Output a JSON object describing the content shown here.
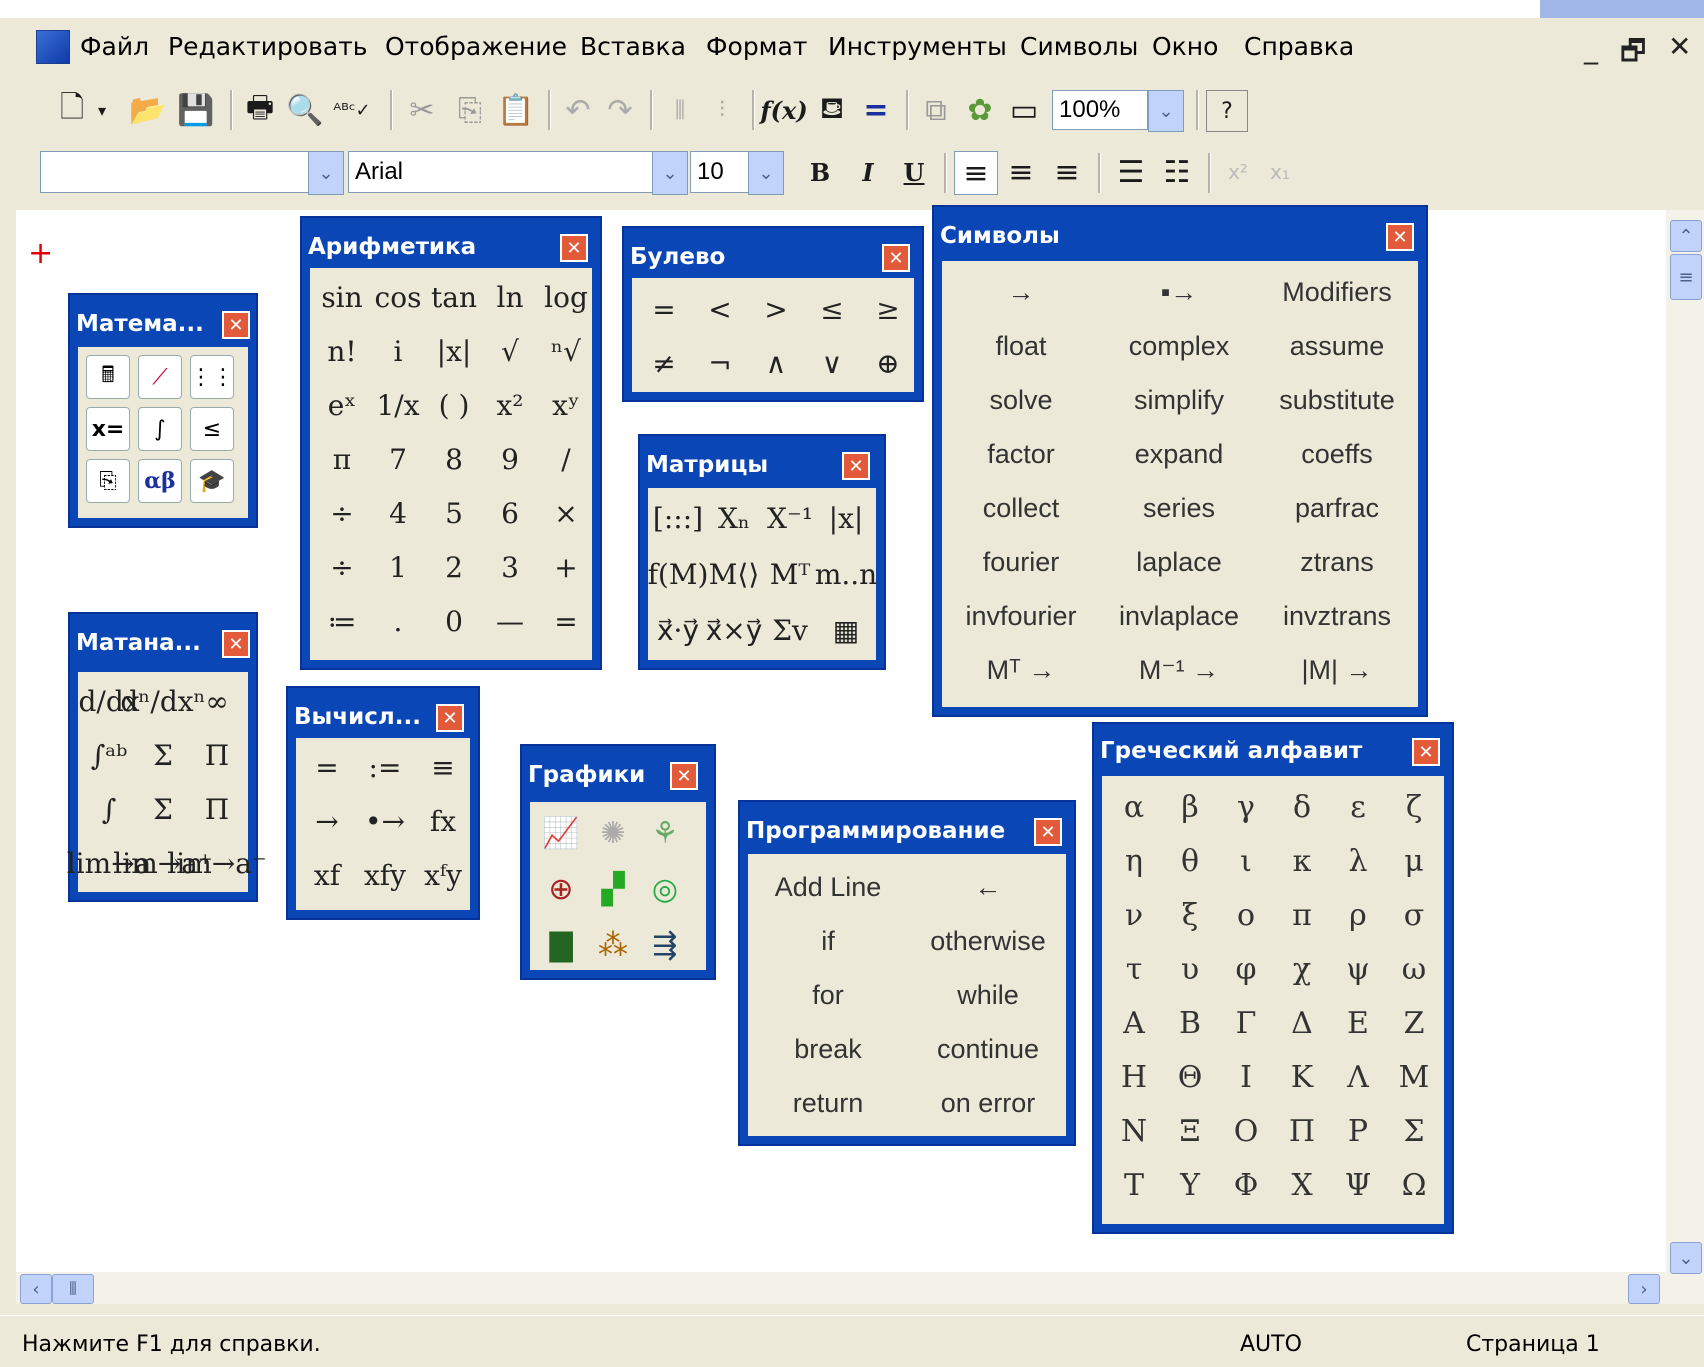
{
  "menu": [
    "Файл",
    "Редактировать",
    "Отображение",
    "Вставка",
    "Формат",
    "Инструменты",
    "Символы",
    "Окно",
    "Справка"
  ],
  "window_controls": {
    "minimize": "_",
    "maximize": "🗗",
    "close": "✕"
  },
  "toolbar": {
    "zoom": "100%",
    "font": "Arial",
    "size": "10",
    "style": "",
    "bold": "B",
    "italic": "I",
    "underline": "U"
  },
  "palettes": {
    "math": {
      "title": "Матема..."
    },
    "calculus": {
      "title": "Матана...",
      "cells": [
        "d/dx",
        "dⁿ/dxⁿ",
        "∞",
        "∫ᵃᵇ",
        "Σ",
        "Π",
        "∫",
        "Σ",
        "Π",
        "lim→a",
        "lim→a⁺",
        "lim→a⁻"
      ]
    },
    "arith": {
      "title": "Арифметика",
      "cells": [
        "sin",
        "cos",
        "tan",
        "ln",
        "log",
        "n!",
        "i",
        "|x|",
        "√",
        "ⁿ√",
        "eˣ",
        "1/x",
        "( )",
        "x²",
        "xʸ",
        "π",
        "7",
        "8",
        "9",
        "/",
        "÷",
        "4",
        "5",
        "6",
        "×",
        "÷",
        "1",
        "2",
        "3",
        "+",
        "≔",
        ".",
        "0",
        "—",
        "="
      ]
    },
    "eval": {
      "title": "Вычисл...",
      "cells": [
        "=",
        ":=",
        "≡",
        "→",
        "•→",
        "fx",
        "xf",
        "xfy",
        "xᶠy"
      ]
    },
    "bool": {
      "title": "Булево",
      "cells": [
        "=",
        "<",
        ">",
        "≤",
        "≥",
        "≠",
        "¬",
        "∧",
        "∨",
        "⊕"
      ]
    },
    "matrix": {
      "title": "Матрицы",
      "cells": [
        "[:::]",
        "Xₙ",
        "X⁻¹",
        "|x|",
        "f(M)",
        "M⟨⟩",
        "Mᵀ",
        "m..n",
        "x⃗·y⃗",
        "x⃗×y⃗",
        "Σv",
        "▦"
      ]
    },
    "graph": {
      "title": "Графики"
    },
    "symbols": {
      "title": "Символы",
      "cells": [
        "→",
        "▪→",
        "Modifiers",
        "float",
        "complex",
        "assume",
        "solve",
        "simplify",
        "substitute",
        "factor",
        "expand",
        "coeffs",
        "collect",
        "series",
        "parfrac",
        "fourier",
        "laplace",
        "ztrans",
        "invfourier",
        "invlaplace",
        "invztrans",
        "Mᵀ →",
        "M⁻¹ →",
        "|M| →"
      ]
    },
    "prog": {
      "title": "Программирование",
      "cells": [
        "Add Line",
        "←",
        "if",
        "otherwise",
        "for",
        "while",
        "break",
        "continue",
        "return",
        "on error"
      ]
    },
    "greek": {
      "title": "Греческий алфавит",
      "cells": [
        "α",
        "β",
        "γ",
        "δ",
        "ε",
        "ζ",
        "η",
        "θ",
        "ι",
        "κ",
        "λ",
        "μ",
        "ν",
        "ξ",
        "ο",
        "π",
        "ρ",
        "σ",
        "τ",
        "υ",
        "φ",
        "χ",
        "ψ",
        "ω",
        "Α",
        "Β",
        "Γ",
        "Δ",
        "Ε",
        "Ζ",
        "Η",
        "Θ",
        "Ι",
        "Κ",
        "Λ",
        "Μ",
        "Ν",
        "Ξ",
        "Ο",
        "Π",
        "Ρ",
        "Σ",
        "Τ",
        "Υ",
        "Φ",
        "Χ",
        "Ψ",
        "Ω"
      ]
    },
    "close_glyph": "✕"
  },
  "status": {
    "help": "Нажмите F1 для справки.",
    "mode": "AUTO",
    "page": "Страница 1"
  },
  "colors": {
    "palette_title": "#0a46b5",
    "palette_body": "#ece9d8",
    "close": "#e35a3a",
    "cursor": "#e00000"
  }
}
